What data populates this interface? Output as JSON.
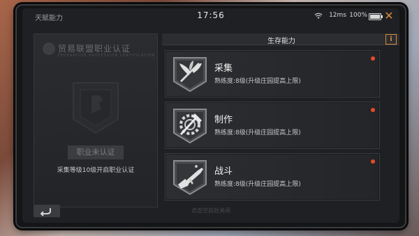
{
  "status": {
    "app_title": "天赋能力",
    "clock": "17:56",
    "ping": "12ms",
    "battery": "100%",
    "battery_level": 1.0
  },
  "left_panel": {
    "title": "贸易联盟职业认证",
    "subtitle": "FEDERATION PROFESSION CERTIFICATION",
    "button_label": "职业未认证",
    "hint": "采集等级10级开启职业认证"
  },
  "right_panel": {
    "header": "生存能力",
    "info_label": "i"
  },
  "skills": [
    {
      "name": "采集",
      "desc": "熟练度:8级(升级庄园提高上限)",
      "icon": "leaf-sickle-icon"
    },
    {
      "name": "制作",
      "desc": "熟练度:8级(升级庄园提高上限)",
      "icon": "hammer-gear-icon"
    },
    {
      "name": "战斗",
      "desc": "熟练度:8级(升级庄园提高上限)",
      "icon": "rifle-icon"
    }
  ],
  "footer": {
    "text": "点击空白处关闭"
  },
  "colors": {
    "accent": "#d88a3a",
    "alert": "#e84a2a"
  }
}
